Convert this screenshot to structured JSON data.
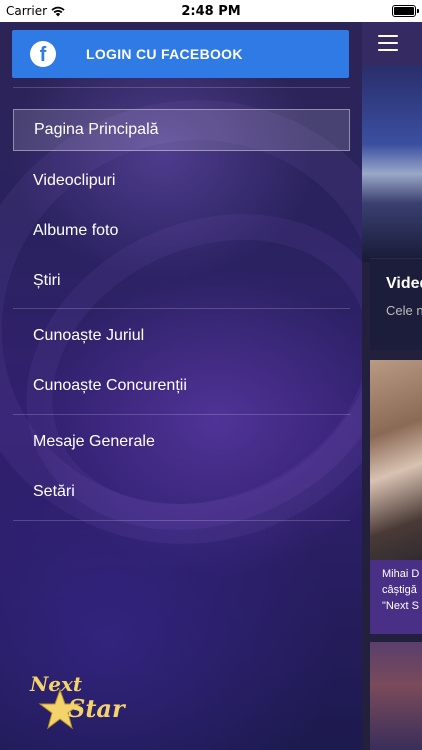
{
  "status_bar": {
    "carrier": "Carrier",
    "time": "2:48 PM"
  },
  "drawer": {
    "facebook_login": "LOGIN CU FACEBOOK",
    "menu_items": [
      {
        "label": "Pagina Principală",
        "active": true
      },
      {
        "label": "Videoclipuri",
        "active": false
      },
      {
        "label": "Albume foto",
        "active": false
      },
      {
        "label": "Știri",
        "active": false
      },
      {
        "label": "Cunoaște Juriul",
        "active": false
      },
      {
        "label": "Cunoaște Concurenții",
        "active": false
      },
      {
        "label": "Mesaje Generale",
        "active": false
      },
      {
        "label": "Setări",
        "active": false
      }
    ],
    "logo": {
      "text_top": "Next",
      "text_bottom": "Star"
    }
  },
  "main_peek": {
    "card_title": "Vided",
    "card_subtitle": "Cele n",
    "caption_lines": [
      "Mihai D",
      "câștigă",
      "\"Next S"
    ]
  },
  "colors": {
    "facebook_blue": "#2f7ae5",
    "caption_purple": "#4a2f86",
    "logo_gold": "#f3d36a"
  }
}
